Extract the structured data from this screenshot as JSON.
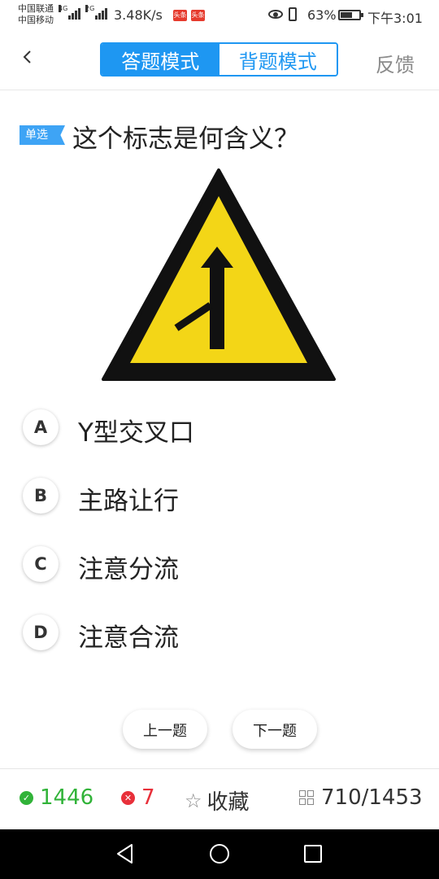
{
  "status_bar": {
    "carrier1": "中国联通",
    "carrier2": "中国移动",
    "net1": "4G",
    "net2": "2G",
    "speed": "3.48K/s",
    "app_icon_1": "头条",
    "app_icon_2": "头条",
    "battery": "63%",
    "time": "下午3:01"
  },
  "header": {
    "tab_answer": "答题模式",
    "tab_recite": "背题模式",
    "feedback": "反馈"
  },
  "question": {
    "type_tag": "单选",
    "text": "这个标志是何含义？",
    "image_icon": "merging-traffic-warning-sign"
  },
  "options": [
    {
      "letter": "A",
      "text": "Y型交叉口"
    },
    {
      "letter": "B",
      "text": "主路让行"
    },
    {
      "letter": "C",
      "text": "注意分流"
    },
    {
      "letter": "D",
      "text": "注意合流"
    }
  ],
  "nav": {
    "prev": "上一题",
    "next": "下一题"
  },
  "stats": {
    "correct": "1446",
    "wrong": "7",
    "favorite": "收藏",
    "progress": "710/1453"
  },
  "colors": {
    "accent": "#1e97f2",
    "correct": "#31b339",
    "wrong": "#e8303a",
    "sign_yellow": "#f3d617"
  }
}
